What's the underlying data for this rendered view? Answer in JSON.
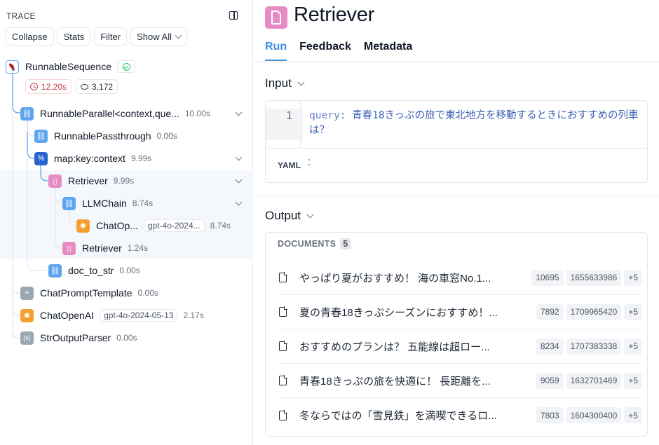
{
  "trace": {
    "label": "TRACE",
    "toolbar": {
      "collapse": "Collapse",
      "stats": "Stats",
      "filter": "Filter",
      "show_all": "Show All"
    },
    "root": {
      "name": "RunnableSequence",
      "status": "success",
      "latency": "12.20s",
      "tokens": "3,172"
    },
    "nodes": [
      {
        "name": "RunnableParallel<context,que...",
        "duration": "10.00s",
        "icon": "link-icon",
        "expandable": true
      },
      {
        "name": "RunnablePassthrough",
        "duration": "0.00s",
        "icon": "link-icon"
      },
      {
        "name": "map:key:context",
        "duration": "9.99s",
        "icon": "map-icon",
        "expandable": true
      },
      {
        "name": "Retriever",
        "duration": "9.99s",
        "icon": "document-icon",
        "expandable": true,
        "selected": true
      },
      {
        "name": "LLMChain",
        "duration": "8.74s",
        "icon": "link-icon",
        "expandable": true
      },
      {
        "name": "ChatOp...",
        "model": "gpt-4o-2024...",
        "duration": "8.74s",
        "icon": "openai-icon"
      },
      {
        "name": "Retriever",
        "duration": "1.24s",
        "icon": "document-icon"
      },
      {
        "name": "doc_to_str",
        "duration": "0.00s",
        "icon": "link-icon"
      },
      {
        "name": "ChatPromptTemplate",
        "duration": "0.00s",
        "icon": "chat-prompt-icon"
      },
      {
        "name": "ChatOpenAI",
        "model": "gpt-4o-2024-05-13",
        "duration": "2.17s",
        "icon": "openai-icon"
      },
      {
        "name": "StrOutputParser",
        "duration": "0.00s",
        "icon": "parser-icon"
      }
    ]
  },
  "detail": {
    "title": "Retriever",
    "tabs": [
      "Run",
      "Feedback",
      "Metadata"
    ],
    "active_tab": "Run",
    "input": {
      "heading": "Input",
      "line_number": "1",
      "key": "query:",
      "value": " 青春18きっぷの旅で東北地方を移動するときにおすすめの列車は？",
      "format": "YAML"
    },
    "output": {
      "heading": "Output",
      "documents_label": "DOCUMENTS",
      "documents_count": "5",
      "documents": [
        {
          "title": "やっぱり夏がおすすめ！ 海の車窓No.1...",
          "tags": [
            "10695",
            "1655633986",
            "+5"
          ]
        },
        {
          "title": "夏の青春18きっぷシーズンにおすすめ！...",
          "tags": [
            "7892",
            "1709965420",
            "+5"
          ]
        },
        {
          "title": "おすすめのプランは？ 五能線は超ロー...",
          "tags": [
            "8234",
            "1707383338",
            "+5"
          ]
        },
        {
          "title": "青春18きっぷの旅を快適に！ 長距離を...",
          "tags": [
            "9059",
            "1632701469",
            "+5"
          ]
        },
        {
          "title": "冬ならではの「雪見鉄」を満喫できるロ...",
          "tags": [
            "7803",
            "1604300400",
            "+5"
          ]
        }
      ]
    }
  }
}
